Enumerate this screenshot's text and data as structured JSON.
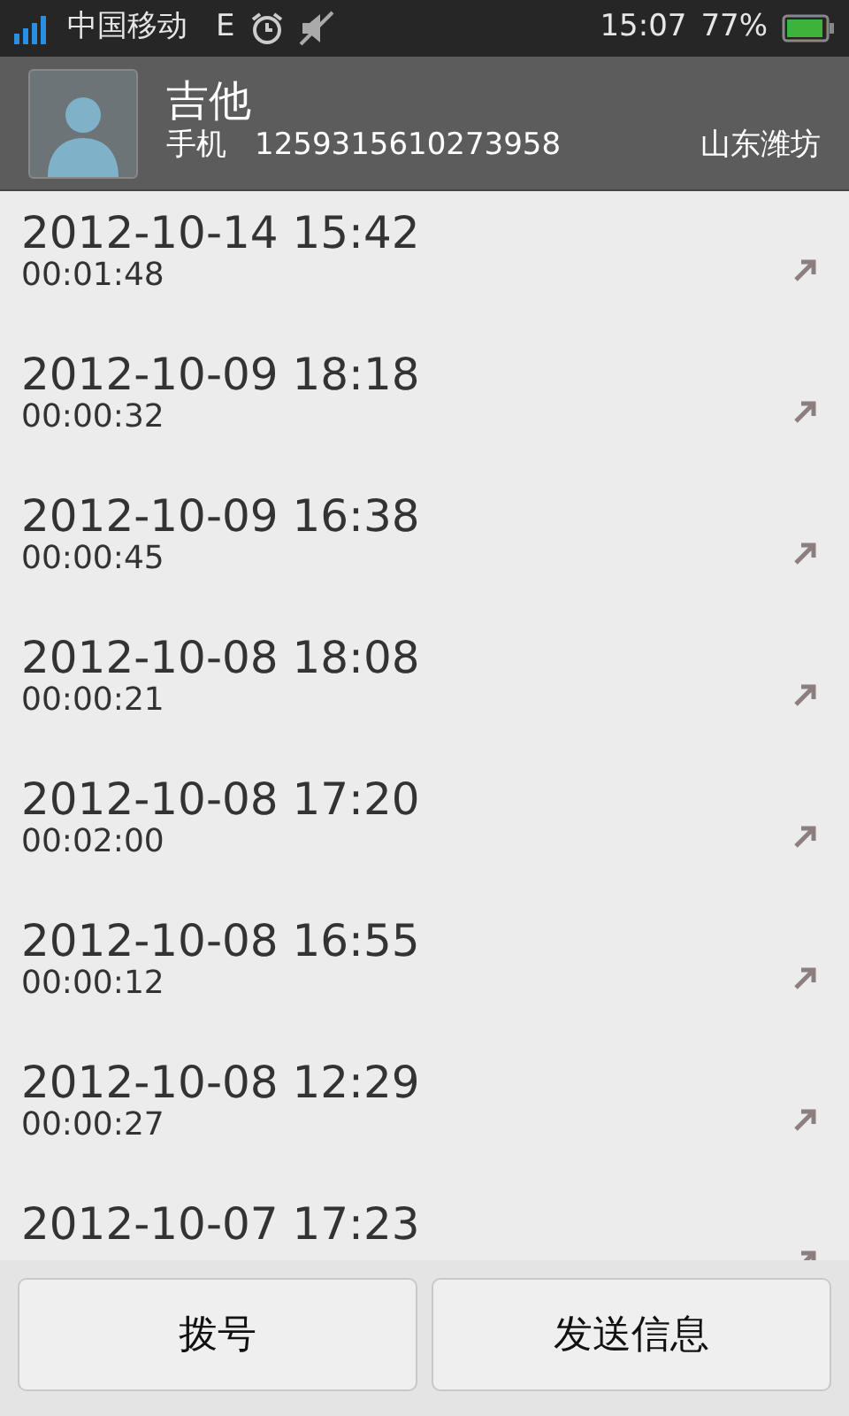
{
  "status_bar": {
    "carrier": "中国移动",
    "network": "E",
    "time": "15:07",
    "battery": "77%"
  },
  "contact": {
    "name": "吉他",
    "phone_label": "手机",
    "phone": "1259315610273958",
    "location": "山东潍坊"
  },
  "calls": [
    {
      "datetime": "2012-10-14 15:42",
      "duration": "00:01:48",
      "kind": "outgoing"
    },
    {
      "datetime": "2012-10-09 18:18",
      "duration": "00:00:32",
      "kind": "outgoing"
    },
    {
      "datetime": "2012-10-09 16:38",
      "duration": "00:00:45",
      "kind": "outgoing"
    },
    {
      "datetime": "2012-10-08 18:08",
      "duration": "00:00:21",
      "kind": "outgoing"
    },
    {
      "datetime": "2012-10-08 17:20",
      "duration": "00:02:00",
      "kind": "outgoing"
    },
    {
      "datetime": "2012-10-08 16:55",
      "duration": "00:00:12",
      "kind": "outgoing"
    },
    {
      "datetime": "2012-10-08 12:29",
      "duration": "00:00:27",
      "kind": "outgoing"
    },
    {
      "datetime": "2012-10-07 17:23",
      "kind": "outgoing"
    }
  ],
  "buttons": [
    "拨号",
    "发送信息"
  ]
}
